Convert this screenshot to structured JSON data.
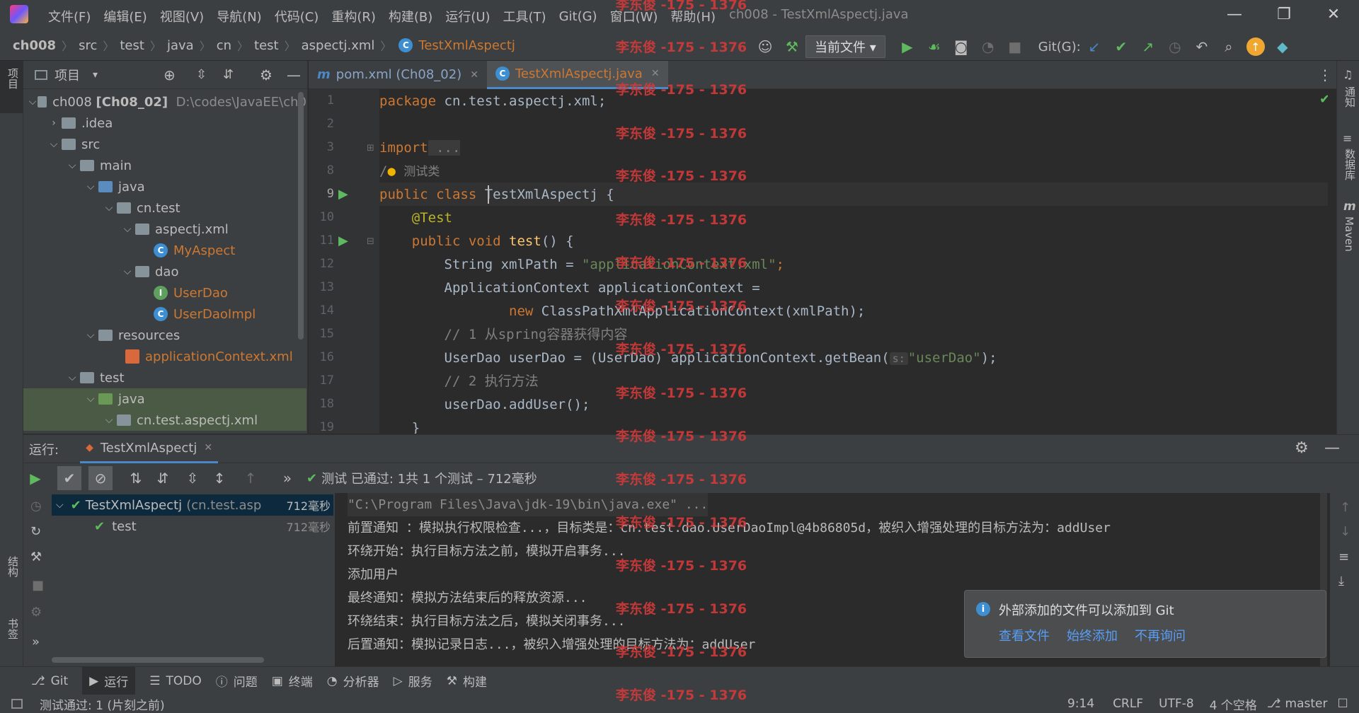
{
  "titlebar": {
    "menu": [
      "文件(F)",
      "编辑(E)",
      "视图(V)",
      "导航(N)",
      "代码(C)",
      "重构(R)",
      "构建(B)",
      "运行(U)",
      "工具(T)",
      "Git(G)",
      "窗口(W)",
      "帮助(H)"
    ],
    "title": "ch008 - TestXmlAspectj.java"
  },
  "breadcrumb": [
    "ch008",
    "src",
    "test",
    "java",
    "cn",
    "test",
    "aspectj.xml",
    "TestXmlAspectj"
  ],
  "navbar": {
    "run_config": "当前文件",
    "git_label": "Git(G):"
  },
  "left_stripe": {
    "project": "项目",
    "structure": "结构",
    "bookmarks": "书签"
  },
  "right_stripe": {
    "notifications": "通知",
    "database": "数据库",
    "maven": "Maven"
  },
  "project_panel": {
    "title": "项目",
    "root_name": "ch008",
    "root_module": "[Ch08_02]",
    "root_path": "D:\\codes\\JavaEE\\ch0",
    "items": [
      ".idea",
      "src",
      "main",
      "java",
      "cn.test",
      "aspectj.xml",
      "MyAspect",
      "dao",
      "UserDao",
      "UserDaoImpl",
      "resources",
      "applicationContext.xml",
      "test",
      "java",
      "cn.test.aspectj.xml"
    ]
  },
  "editor": {
    "tabs": [
      {
        "label": "pom.xml (Ch08_02)"
      },
      {
        "label": "TestXmlAspectj.java"
      }
    ],
    "line_numbers": [
      "1",
      "2",
      "3",
      "8",
      "9",
      "10",
      "11",
      "12",
      "13",
      "14",
      "15",
      "16",
      "17",
      "18",
      "19"
    ],
    "lines": {
      "l1_kw": "package",
      "l1_rest": " cn.test.aspectj.xml;",
      "l3_kw": "import",
      "l3_rest": " ...",
      "l8": "测试类",
      "l9_kw": "public class",
      "l9_rest": " TestXmlAspectj {",
      "l10": "@Test",
      "l11_kw": "public void",
      "l11_fn": " test",
      "l11_rest": "() {",
      "l12_a": "String xmlPath = ",
      "l12_str": "\"applicationContext.xml\"",
      "l12_b": ";",
      "l13": "ApplicationContext applicationContext =",
      "l14_kw": "new",
      "l14_rest": " ClassPathXmlApplicationContext(xmlPath);",
      "l15": "// 1 从spring容器获得内容",
      "l16_a": "UserDao userDao = (UserDao) applicationContext.getBean(",
      "l16_hint": "s:",
      "l16_str": "\"userDao\"",
      "l16_b": ");",
      "l17": "// 2 执行方法",
      "l18": "userDao.addUser();",
      "l19": "}"
    }
  },
  "run_panel": {
    "label": "运行:",
    "config": "TestXmlAspectj",
    "status": "测试 已通过: 1共 1 个测试 – 712毫秒",
    "tree": [
      {
        "name": "TestXmlAspectj",
        "detail": "(cn.test.asp",
        "time": "712毫秒"
      },
      {
        "name": "test",
        "time": "712毫秒"
      }
    ],
    "console": [
      "\"C:\\Program Files\\Java\\jdk-19\\bin\\java.exe\" ...",
      "前置通知 ：模拟执行权限检查...，目标类是：cn.test.dao.UserDaoImpl@4b86805d，被织入增强处理的目标方法为：addUser",
      "环绕开始：执行目标方法之前，模拟开启事务...",
      "添加用户",
      "最终通知：模拟方法结束后的释放资源...",
      "环绕结束：执行目标方法之后，模拟关闭事务...",
      "后置通知：模拟记录日志...，被织入增强处理的目标方法为：addUser"
    ]
  },
  "notification": {
    "message": "外部添加的文件可以添加到 Git",
    "actions": [
      "查看文件",
      "始终添加",
      "不再询问"
    ]
  },
  "bottom_tabs": [
    "Git",
    "运行",
    "TODO",
    "问题",
    "终端",
    "分析器",
    "服务",
    "构建"
  ],
  "status_bar": {
    "message": "测试通过: 1 (片刻之前)",
    "position": "9:14",
    "line_sep": "CRLF",
    "encoding": "UTF-8",
    "indent": "4 个空格",
    "branch": "master"
  },
  "watermark": "李东俊 -175 - 1376",
  "colors": {
    "accent": "#4a88c7",
    "keyword": "#cc7832",
    "string": "#6a8759",
    "comment": "#808080",
    "pass": "#5fb95f",
    "watermark": "#d33a3a"
  }
}
